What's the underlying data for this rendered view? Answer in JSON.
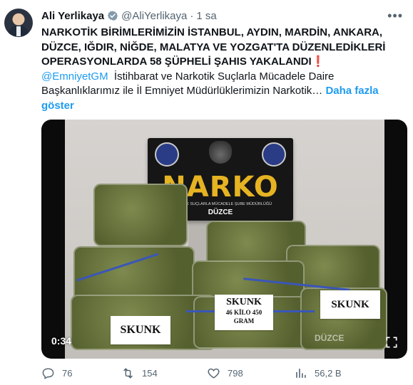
{
  "tweet": {
    "author_name": "Ali Yerlikaya",
    "handle": "@AliYerlikaya",
    "separator": "·",
    "time": "1 sa",
    "headline": "NARKOTİK BİRİMLERİMİZİN İSTANBUL, AYDIN, MARDİN, ANKARA, DÜZCE, IĞDIR, NİĞDE, MALATYA VE YOZGAT'TA DÜZENLEDİKLERİ OPERASYONLARDA 58 ŞÜPHELİ ŞAHIS YAKALANDI",
    "exclamation": "❗",
    "mention": "@EmniyetGM",
    "body": "İstihbarat ve Narkotik Suçlarla Mücadele Daire Başkanlıklarımız ile  İl Emniyet Müdürlüklerimizin Narkotik…",
    "show_more": "Daha fazla göster"
  },
  "media": {
    "timecode": "0:34",
    "box_title": "NARKO",
    "box_subtitle": "NARKOTİK SUÇLARLA MÜCADELE ŞUBE MÜDÜRLÜĞÜ",
    "box_city": "DÜZCE",
    "label_left": "SKUNK",
    "label_center_title": "SKUNK",
    "label_center_amount": "46 KİLO 450",
    "label_center_unit": "GRAM",
    "label_right": "SKUNK",
    "watermark": "DÜZCE"
  },
  "actions": {
    "replies": "76",
    "retweets": "154",
    "likes": "798",
    "views": "56,2 B"
  },
  "colors": {
    "link": "#1d9bf0",
    "muted": "#536471",
    "verified": "#829aab"
  },
  "icons": [
    "verified-badge-icon",
    "more-icon",
    "fullscreen-icon",
    "reply-icon",
    "retweet-icon",
    "like-icon",
    "views-icon"
  ]
}
